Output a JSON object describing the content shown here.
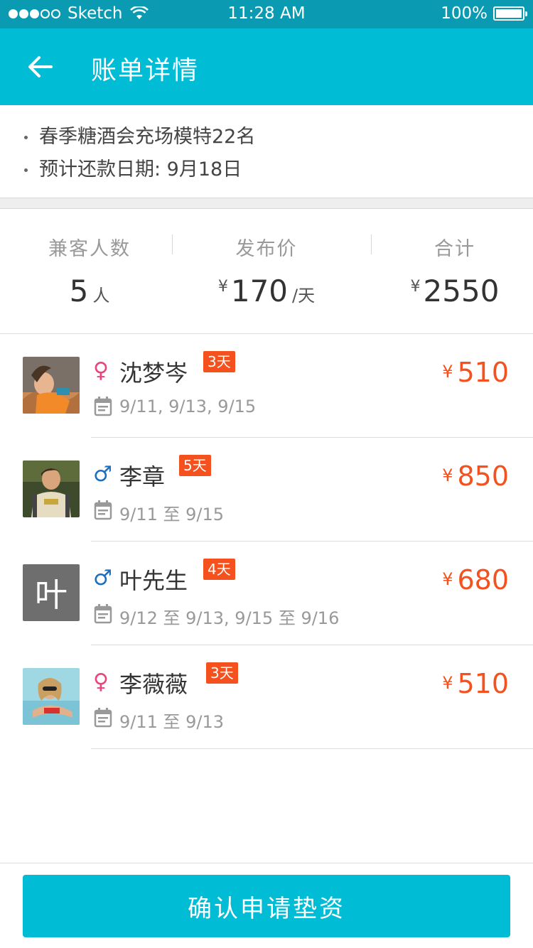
{
  "status_bar": {
    "carrier": "Sketch",
    "time": "11:28 AM",
    "battery": "100%"
  },
  "nav": {
    "title": "账单详情"
  },
  "info": {
    "lines": [
      "春季糖酒会充场模特22名",
      "预计还款日期: 9月18日"
    ]
  },
  "summary": {
    "count_label": "兼客人数",
    "count_value": "5",
    "count_unit": "人",
    "price_label": "发布价",
    "price_currency": "¥",
    "price_value": "170",
    "price_unit": "/天",
    "total_label": "合计",
    "total_currency": "¥",
    "total_value": "2550"
  },
  "workers": [
    {
      "name": "沈梦岑",
      "gender_symbol": "♀",
      "days": "3天",
      "dates": "9/11, 9/13, 9/15",
      "currency": "¥",
      "amount": "510"
    },
    {
      "name": "李章",
      "gender_symbol": "♂",
      "days": "5天",
      "dates": "9/11 至 9/15",
      "currency": "¥",
      "amount": "850"
    },
    {
      "name": "叶先生",
      "gender_symbol": "♂",
      "days": "4天",
      "dates": "9/12 至 9/13, 9/15 至 9/16",
      "currency": "¥",
      "amount": "680",
      "avatar_text": "叶"
    },
    {
      "name": "李薇薇",
      "gender_symbol": "♀",
      "days": "3天",
      "dates": "9/11 至 9/13",
      "currency": "¥",
      "amount": "510"
    }
  ],
  "footer": {
    "confirm_label": "确认申请垫资"
  },
  "colors": {
    "primary": "#00bcd4",
    "status_bar": "#0a9bb3",
    "accent": "#f4511e",
    "female": "#e9457a",
    "male": "#1a6fc0"
  }
}
